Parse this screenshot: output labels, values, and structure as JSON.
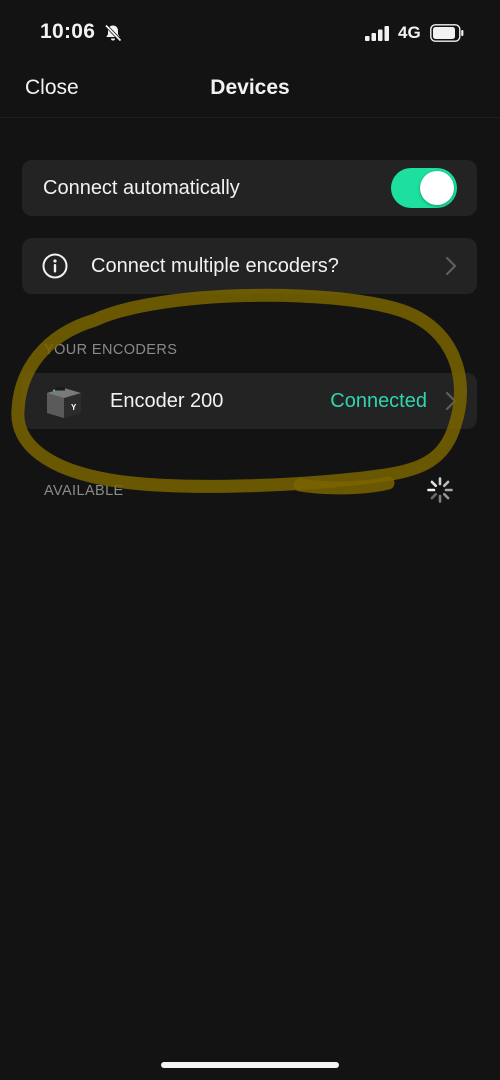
{
  "status_bar": {
    "time": "10:06",
    "network": "4G",
    "icons": [
      "bell-slash-icon",
      "signal-icon",
      "battery-icon"
    ]
  },
  "nav": {
    "close_label": "Close",
    "title": "Devices"
  },
  "settings": {
    "connect_automatically_label": "Connect automatically",
    "connect_automatically_on": true,
    "multiple_encoders_label": "Connect multiple encoders?"
  },
  "sections": {
    "your_encoders": "YOUR ENCODERS",
    "available": "AVAILABLE"
  },
  "encoders": [
    {
      "name": "Encoder 200",
      "status": "Connected"
    }
  ],
  "colors": {
    "accent_toggle": "#1de0a0",
    "status_connected": "#2ed5b0",
    "annotation": "#7a6400"
  }
}
